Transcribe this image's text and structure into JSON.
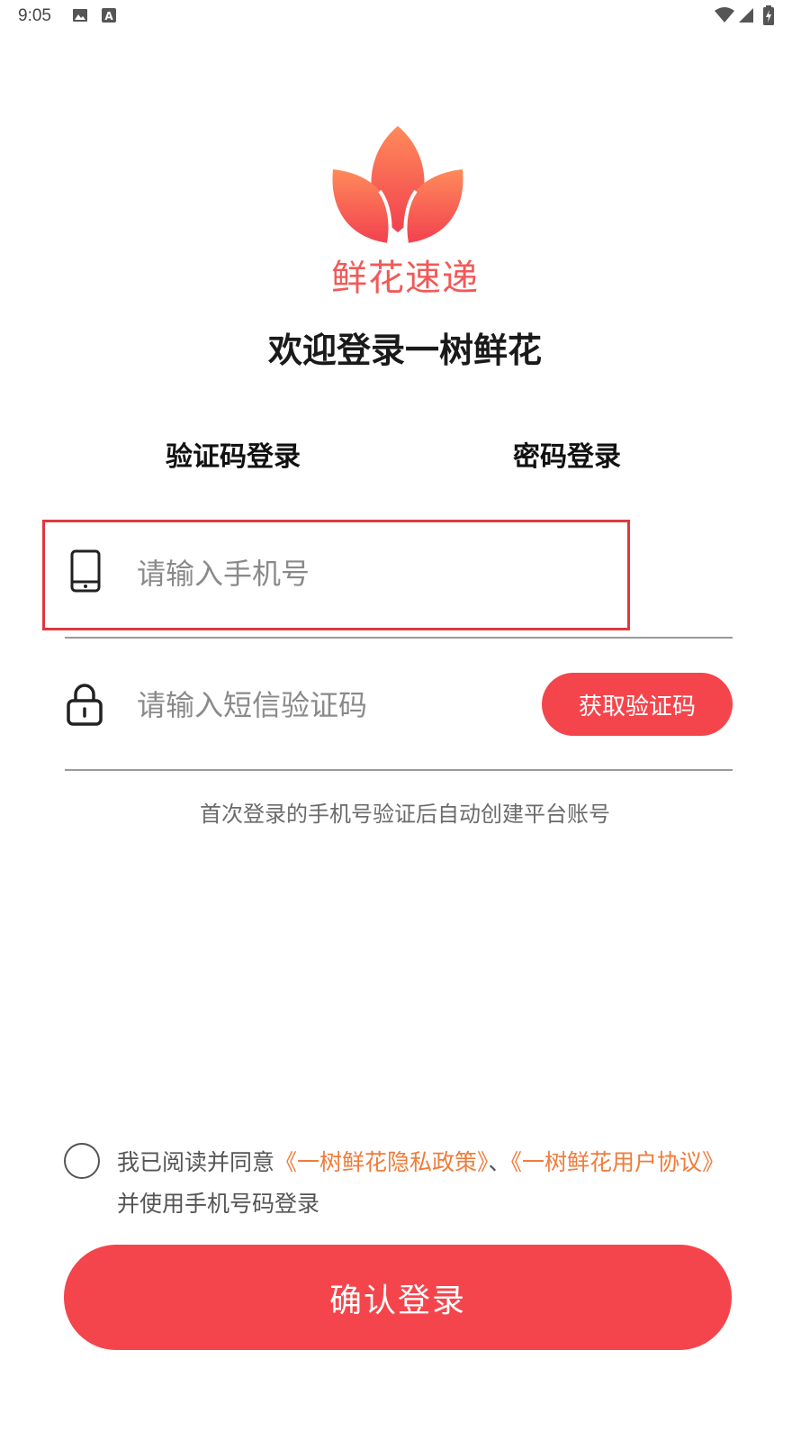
{
  "status_bar": {
    "time": "9:05",
    "icons": [
      "image-icon",
      "font-a-icon",
      "wifi-icon",
      "cell-signal-icon",
      "battery-charging-icon"
    ]
  },
  "brand": {
    "logo_icon": "flower-petals-icon",
    "name": "鲜花速递",
    "color": "#f15a59"
  },
  "welcome_title": "欢迎登录一树鲜花",
  "tabs": [
    {
      "label": "验证码登录",
      "active": true
    },
    {
      "label": "密码登录",
      "active": false
    }
  ],
  "phone_field": {
    "icon": "phone-icon",
    "value": "",
    "placeholder": "请输入手机号"
  },
  "sms_field": {
    "icon": "lock-icon",
    "value": "",
    "placeholder": "请输入短信验证码",
    "get_code_label": "获取验证码"
  },
  "hint": "首次登录的手机号验证后自动创建平台账号",
  "agreement": {
    "checked": false,
    "prefix": "我已阅读并同意",
    "privacy_link": "《一树鲜花隐私政策》",
    "separator": "、",
    "user_link": "《一树鲜花用户协议》",
    "suffix": "并使用手机号码登录"
  },
  "login_button": "确认登录",
  "colors": {
    "accent": "#f5454c",
    "link": "#f07c3a",
    "highlight_border": "#e0383f"
  }
}
